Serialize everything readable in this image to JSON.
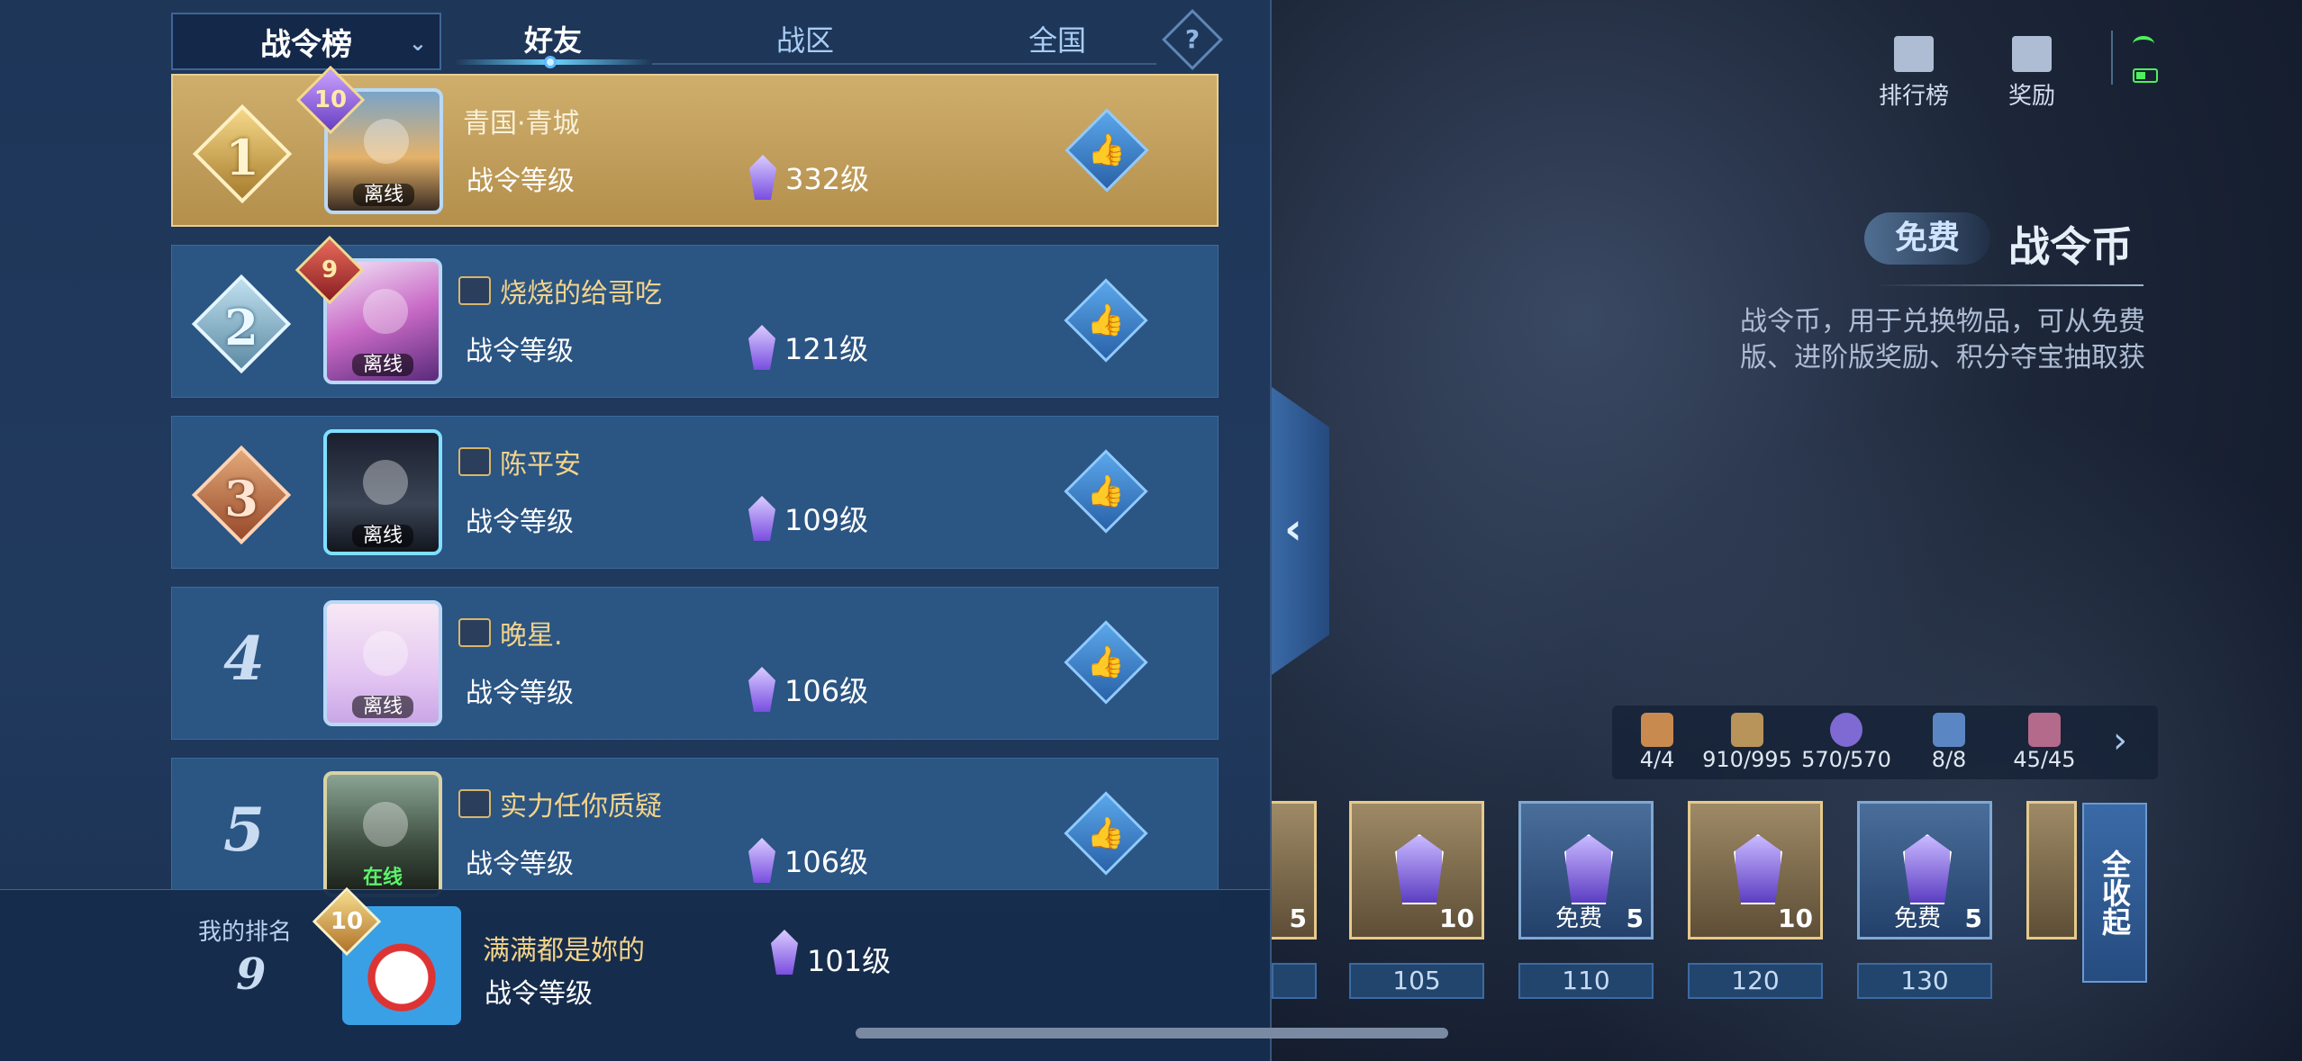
{
  "header": {
    "board_select": "战令榜",
    "tabs": [
      {
        "label": "好友",
        "active": true
      },
      {
        "label": "战区",
        "active": false
      },
      {
        "label": "全国",
        "active": false
      }
    ],
    "help_symbol": "?"
  },
  "rows": [
    {
      "rank": "1",
      "name": "青国·青城",
      "level_badge": "10",
      "status": "离线",
      "sub_label": "战令等级",
      "level": "332级"
    },
    {
      "rank": "2",
      "name": "烧烧的给哥吃",
      "level_badge": "9",
      "status": "离线",
      "sub_label": "战令等级",
      "level": "121级"
    },
    {
      "rank": "3",
      "name": "陈平安",
      "level_badge": "",
      "status": "离线",
      "sub_label": "战令等级",
      "level": "109级"
    },
    {
      "rank": "4",
      "name": "晚星.",
      "level_badge": "",
      "status": "离线",
      "sub_label": "战令等级",
      "level": "106级"
    },
    {
      "rank": "5",
      "name": "实力任你质疑",
      "level_badge": "",
      "status": "在线",
      "sub_label": "战令等级",
      "level": "106级"
    }
  ],
  "my_rank": {
    "label": "我的排名",
    "rank": "9",
    "level_badge": "10",
    "name": "满满都是妳的",
    "sub_label": "战令等级",
    "level": "101级"
  },
  "right": {
    "icons": [
      {
        "label": "排行榜",
        "icon": "chart-bar-icon"
      },
      {
        "label": "奖励",
        "icon": "gift-chest-icon"
      }
    ],
    "coin_tag": "免费",
    "coin_title": "战令币",
    "coin_desc": "战令币，用于兑换物品，可从免费版、进阶版奖励、积分夺宝抽取获",
    "resources": [
      "4/4",
      "910/995",
      "570/570",
      "8/8",
      "45/45"
    ],
    "cards": [
      {
        "qty": "10",
        "free": ""
      },
      {
        "qty": "5",
        "free": "免费"
      },
      {
        "qty": "10",
        "free": ""
      },
      {
        "qty": "5",
        "free": "免费"
      }
    ],
    "partial_card_qty": "5",
    "levels": [
      "105",
      "110",
      "120",
      "130"
    ],
    "collect_all": "全收起"
  },
  "colors": {
    "panel_bg": "#203a5e",
    "row_bg": "#2b5583",
    "gold_row": "#c4a25e",
    "name_gold": "#f3d38a",
    "online_green": "#5cf36a"
  }
}
